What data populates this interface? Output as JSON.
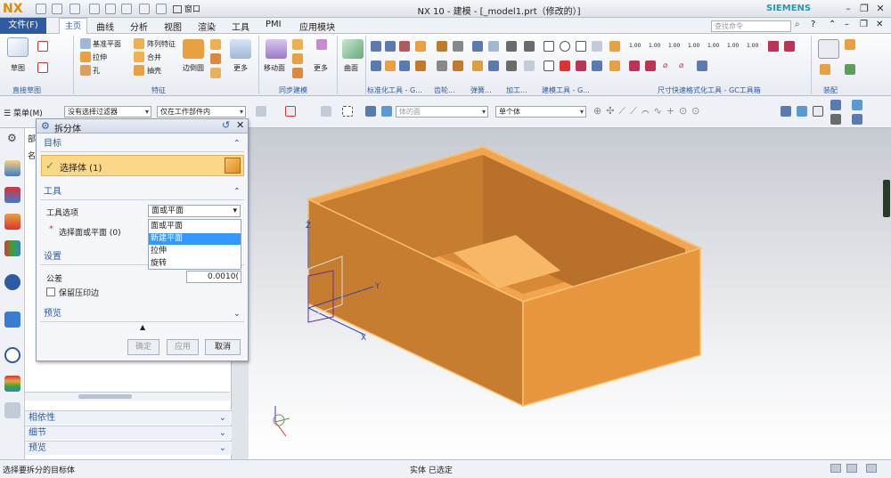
{
  "app": {
    "logo": "NX",
    "title": "NX 10 - 建模 - [_model1.prt（修改的）]",
    "brand": "SIEMENS",
    "window_menu": "窗口"
  },
  "menubar": {
    "file": "文件(F)",
    "tabs": [
      "主页",
      "曲线",
      "分析",
      "视图",
      "渲染",
      "工具",
      "PMI",
      "应用模块"
    ],
    "search_placeholder": "查找命令"
  },
  "ribbon": {
    "sketch": "草图",
    "datum_plane": "基准平面",
    "pattern_feature": "阵列特征",
    "extrude": "拉伸",
    "unite": "合并",
    "hole": "孔",
    "shell": "抽壳",
    "edge_blend": "边倒圆",
    "more1": "更多",
    "move_face": "移动面",
    "more2": "更多",
    "surface": "曲面",
    "more3": "更多",
    "groups": [
      "直接草图",
      "特征",
      "同步建模",
      "标准化工具 - G...",
      "齿轮...",
      "弹簧...",
      "加工...",
      "建模工具 - G...",
      "尺寸快速格式化工具 - GC工具箱",
      "装配"
    ],
    "dim_labels": [
      "1.00",
      "1.00",
      "1.00",
      "1.00",
      "1.00",
      "1.00",
      "1.00"
    ]
  },
  "toolbar2": {
    "menu": "菜单(M)",
    "filter": "没有选择过滤器",
    "scope": "仅在工作部件内",
    "body_face": "体的面",
    "single_body": "单个体"
  },
  "dialog": {
    "title": "拆分体",
    "target_section": "目标",
    "select_body": "选择体 (1)",
    "tool_section": "工具",
    "tool_option_label": "工具选项",
    "tool_option_value": "面或平面",
    "dropdown_options": [
      "面或平面",
      "新建平面",
      "拉伸",
      "旋转"
    ],
    "highlighted_option": "新建平面",
    "select_face": "选择面或平面 (0)",
    "settings_section": "设置",
    "tolerance_label": "公差",
    "tolerance_value": "0.0010(",
    "keep_imprint": "保留压印边",
    "preview_section": "预览",
    "ok": "确定",
    "apply": "应用",
    "cancel": "取消"
  },
  "navigator": {
    "part_abbr": "部",
    "name_abbr": "名",
    "sections": [
      "相依性",
      "细节",
      "预览"
    ]
  },
  "axes": {
    "x": "X",
    "y": "Y",
    "z": "Z"
  },
  "status": {
    "left": "选择要拆分的目标体",
    "center": "实体 已选定"
  },
  "colors": {
    "accent": "#2d5aa0",
    "model": "#e59a43",
    "model_dark": "#c77d30",
    "highlight": "#3399ff"
  }
}
